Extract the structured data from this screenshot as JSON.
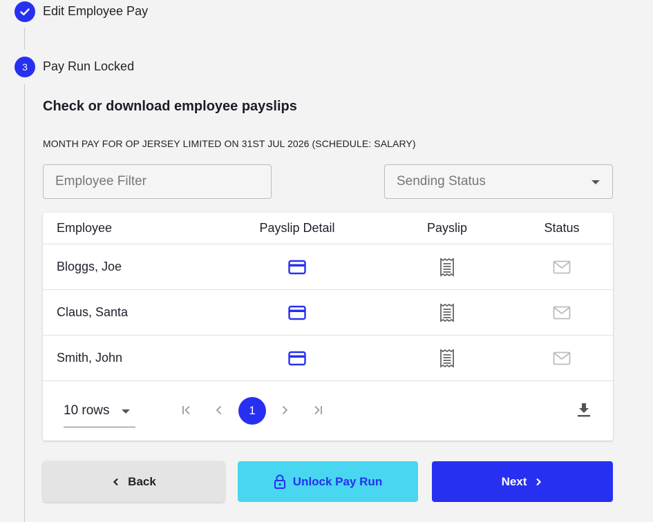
{
  "steps": {
    "edit_pay": {
      "label": "Edit Employee Pay",
      "icon": "check-icon"
    },
    "locked": {
      "number": "3",
      "label": "Pay Run Locked"
    }
  },
  "section": {
    "title": "Check or download employee payslips",
    "subtitle": "MONTH PAY FOR OP JERSEY LIMITED ON 31ST JUL 2026 (SCHEDULE: SALARY)"
  },
  "filters": {
    "employee_placeholder": "Employee Filter",
    "status_placeholder": "Sending Status"
  },
  "table": {
    "headers": [
      "Employee",
      "Payslip Detail",
      "Payslip",
      "Status"
    ],
    "rows": [
      {
        "employee": "Bloggs, Joe",
        "detail_icon": "credit-card-icon",
        "payslip_icon": "receipt-icon",
        "status_icon": "envelope-icon"
      },
      {
        "employee": "Claus, Santa",
        "detail_icon": "credit-card-icon",
        "payslip_icon": "receipt-icon",
        "status_icon": "envelope-icon"
      },
      {
        "employee": "Smith, John",
        "detail_icon": "credit-card-icon",
        "payslip_icon": "receipt-icon",
        "status_icon": "envelope-icon"
      }
    ]
  },
  "pagination": {
    "rows_label": "10 rows",
    "current_page": "1"
  },
  "buttons": {
    "back": "Back",
    "unlock": "Unlock Pay Run",
    "next": "Next"
  },
  "colors": {
    "primary": "#2730f0",
    "unlock_bg": "#48d6f0",
    "back_bg": "#e4e4e4"
  }
}
